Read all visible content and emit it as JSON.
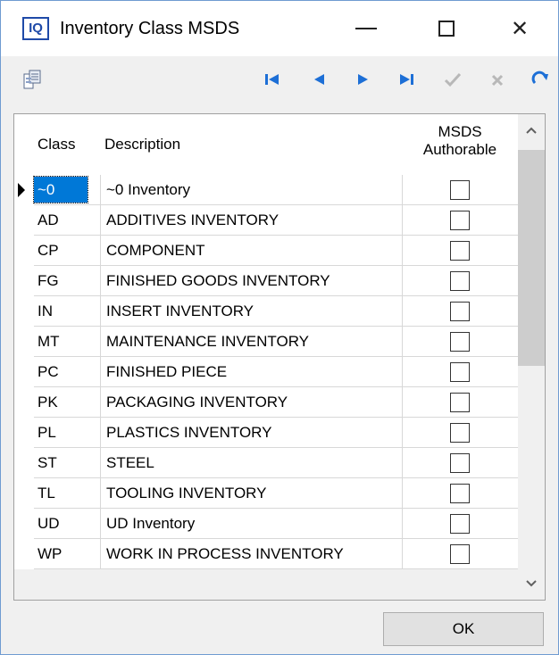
{
  "window": {
    "app_icon_text": "IQ",
    "title": "Inventory Class MSDS",
    "close_glyph": "✕"
  },
  "toolbar": {
    "icons": [
      "report-icon",
      "first-record-icon",
      "prior-record-icon",
      "next-record-icon",
      "last-record-icon",
      "post-icon",
      "cancel-icon",
      "refresh-icon"
    ],
    "colors": {
      "nav": "#1d6fd6",
      "disabled": "#b8b8b8",
      "refresh": "#1d6fd6"
    }
  },
  "grid": {
    "columns": {
      "class": "Class",
      "description": "Description",
      "msds_line1": "MSDS",
      "msds_line2": "Authorable"
    },
    "rows": [
      {
        "class": "~0",
        "description": "~0 Inventory",
        "msds_authorable": false,
        "selected": true
      },
      {
        "class": "AD",
        "description": "ADDITIVES INVENTORY",
        "msds_authorable": false
      },
      {
        "class": "CP",
        "description": "COMPONENT",
        "msds_authorable": false
      },
      {
        "class": "FG",
        "description": "FINISHED GOODS INVENTORY",
        "msds_authorable": false
      },
      {
        "class": "IN",
        "description": "INSERT INVENTORY",
        "msds_authorable": false
      },
      {
        "class": "MT",
        "description": "MAINTENANCE INVENTORY",
        "msds_authorable": false
      },
      {
        "class": "PC",
        "description": "FINISHED PIECE",
        "msds_authorable": false
      },
      {
        "class": "PK",
        "description": "PACKAGING INVENTORY",
        "msds_authorable": false
      },
      {
        "class": "PL",
        "description": "PLASTICS INVENTORY",
        "msds_authorable": false
      },
      {
        "class": "ST",
        "description": "STEEL",
        "msds_authorable": false
      },
      {
        "class": "TL",
        "description": "TOOLING INVENTORY",
        "msds_authorable": false
      },
      {
        "class": "UD",
        "description": "UD Inventory",
        "msds_authorable": false
      },
      {
        "class": "WP",
        "description": "WORK IN PROCESS INVENTORY",
        "msds_authorable": false
      }
    ]
  },
  "footer": {
    "ok_label": "OK"
  }
}
